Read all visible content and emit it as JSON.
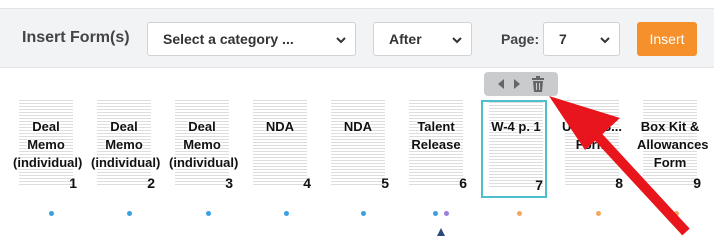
{
  "toolbar": {
    "title": "Insert Form(s)",
    "category_select": "Select a category ...",
    "position_select": "After",
    "page_label": "Page:",
    "page_select": "7",
    "insert_label": "Insert"
  },
  "thumbnails": [
    {
      "label": "Deal Memo (individual)",
      "number": "1",
      "dot_color": "#3aa0e0"
    },
    {
      "label": "Deal Memo (individual)",
      "number": "2",
      "dot_color": "#3aa0e0"
    },
    {
      "label": "Deal Memo (individual)",
      "number": "3",
      "dot_color": "#3aa0e0"
    },
    {
      "label": "NDA",
      "number": "4",
      "dot_color": "#3aa0e0"
    },
    {
      "label": "NDA",
      "number": "5",
      "dot_color": "#3aa0e0"
    },
    {
      "label": "Talent Release",
      "number": "6",
      "dot_color": "#3aa0e0"
    },
    {
      "label": "W-4 p. 1",
      "number": "7",
      "dot_color": "#f5a85a"
    },
    {
      "label": "Union S... Form",
      "number": "8",
      "dot_color": "#f5a85a"
    },
    {
      "label": "Box Kit & Allowances Form",
      "number": "9",
      "dot_color": "#f5a85a"
    }
  ],
  "colors": {
    "accent": "#f5902b",
    "selected_border": "#4fbecb",
    "arrow": "#e8151c"
  },
  "icons": [
    "chevron-left-icon",
    "chevron-right-icon",
    "trash-icon"
  ]
}
